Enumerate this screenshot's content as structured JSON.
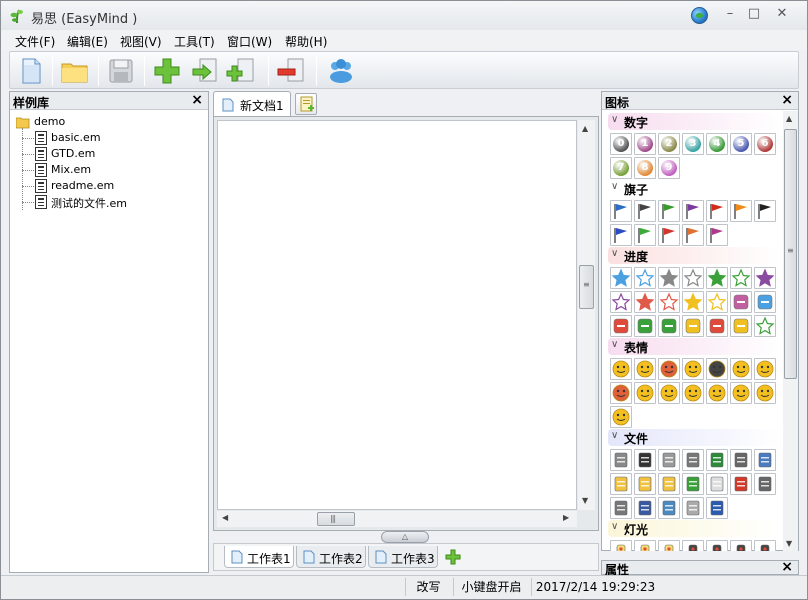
{
  "window": {
    "title": "易思 (EasyMind )"
  },
  "menu": [
    "文件(F)",
    "编辑(E)",
    "视图(V)",
    "工具(T)",
    "窗口(W)",
    "帮助(H)"
  ],
  "toolbar": {
    "buttons": [
      "new-document",
      "open-folder",
      "save",
      "add-node",
      "insert-sibling",
      "insert-child",
      "delete-node",
      "users"
    ]
  },
  "left_panel": {
    "title": "样例库",
    "root": "demo",
    "files": [
      "basic.em",
      "GTD.em",
      "Mix.em",
      "readme.em",
      "测试的文件.em"
    ]
  },
  "document": {
    "tab_label": "新文档1",
    "sheets": [
      "工作表1",
      "工作表2",
      "工作表3"
    ]
  },
  "right_panel": {
    "title": "图标",
    "categories": [
      {
        "name": "数字",
        "color": "#f7dcef"
      },
      {
        "name": "旗子",
        "color": "#ffffff"
      },
      {
        "name": "进度",
        "color": "#fbe0e0"
      },
      {
        "name": "表情",
        "color": "#f7dcef"
      },
      {
        "name": "文件",
        "color": "#e3e6fa"
      },
      {
        "name": "灯光",
        "color": "#fbf6d8"
      }
    ],
    "numbers": [
      "0",
      "1",
      "2",
      "3",
      "4",
      "5",
      "6",
      "7",
      "8",
      "9"
    ]
  },
  "properties_panel": {
    "title": "属性"
  },
  "status": {
    "mode": "改写",
    "keyboard": "小键盘开启",
    "datetime": "2017/2/14 19:29:23"
  }
}
